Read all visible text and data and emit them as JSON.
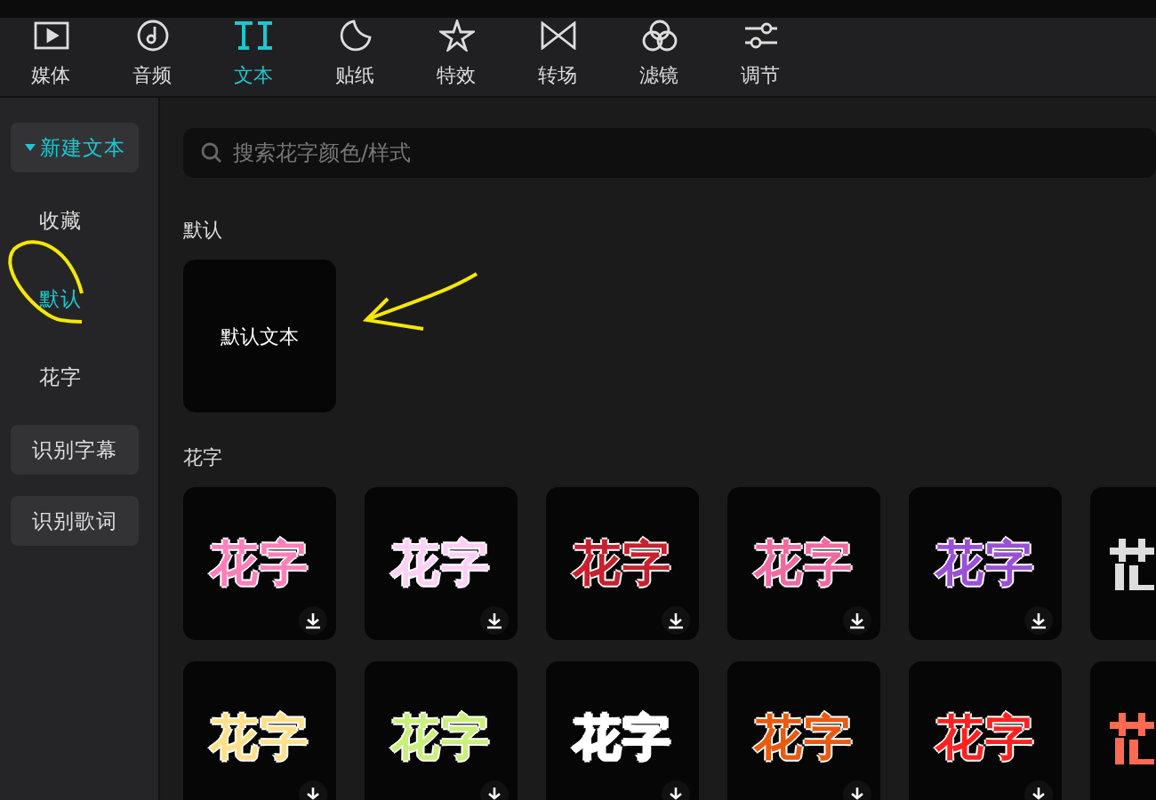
{
  "toolbar": [
    {
      "label": "媒体",
      "selected": false
    },
    {
      "label": "音频",
      "selected": false
    },
    {
      "label": "文本",
      "selected": true
    },
    {
      "label": "贴纸",
      "selected": false
    },
    {
      "label": "特效",
      "selected": false
    },
    {
      "label": "转场",
      "selected": false
    },
    {
      "label": "滤镜",
      "selected": false
    },
    {
      "label": "调节",
      "selected": false
    }
  ],
  "sidebar": {
    "items": [
      {
        "kind": "group",
        "label": "新建文本",
        "expanded": true,
        "selected": false
      },
      {
        "kind": "item",
        "label": "收藏",
        "selected": false
      },
      {
        "kind": "item",
        "label": "默认",
        "selected": true
      },
      {
        "kind": "item",
        "label": "花字",
        "selected": false
      },
      {
        "kind": "group",
        "label": "识别字幕",
        "selected": false
      },
      {
        "kind": "group",
        "label": "识别歌词",
        "selected": false
      }
    ]
  },
  "search": {
    "placeholder": "搜索花字颜色/样式"
  },
  "sections": [
    {
      "title": "默认",
      "kind": "plain",
      "tiles": [
        {
          "text": "默认文本"
        }
      ]
    },
    {
      "title": "花字",
      "kind": "styled",
      "tiles": [
        {
          "text": "花字",
          "color": "#ff7fb8"
        },
        {
          "text": "花字",
          "color": "#ffd0f5"
        },
        {
          "text": "花字",
          "color": "#c8202e"
        },
        {
          "text": "花字",
          "color": "#f06aa0"
        },
        {
          "text": "花字",
          "color": "#9a4fd8"
        },
        {
          "kind": "cut",
          "color": "#dddddd"
        },
        {
          "text": "花字",
          "color": "#ffe08a"
        },
        {
          "text": "花字",
          "color": "#c8f07a"
        },
        {
          "text": "花字",
          "color": "#ffffff"
        },
        {
          "text": "花字",
          "color": "#e85a10"
        },
        {
          "text": "花字",
          "color": "#ff2020"
        },
        {
          "kind": "cut",
          "color": "#ff6a50"
        }
      ]
    }
  ]
}
